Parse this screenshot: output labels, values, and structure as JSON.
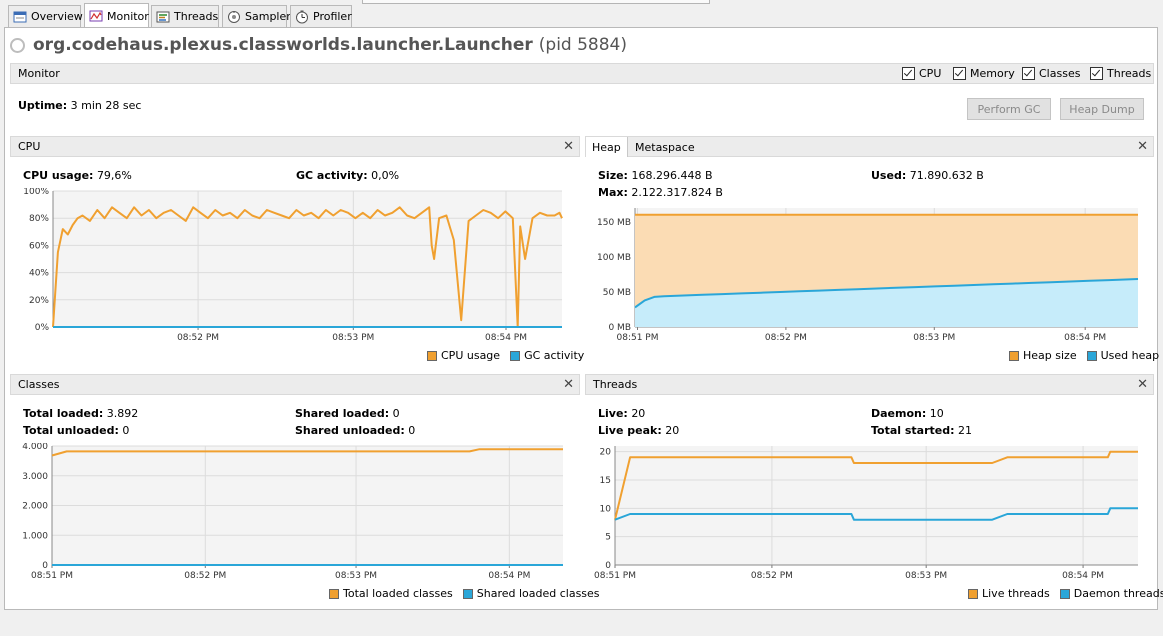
{
  "tabs": [
    {
      "label": "Overview",
      "icon": "overview-icon"
    },
    {
      "label": "Monitor",
      "icon": "monitor-icon"
    },
    {
      "label": "Threads",
      "icon": "threads-icon"
    },
    {
      "label": "Sampler",
      "icon": "sampler-icon"
    },
    {
      "label": "Profiler",
      "icon": "profiler-icon"
    }
  ],
  "app": {
    "name": "org.codehaus.plexus.classworlds.launcher.Launcher",
    "pid": "(pid 5884)"
  },
  "monitor": {
    "label": "Monitor",
    "checks": [
      {
        "label": "CPU"
      },
      {
        "label": "Memory"
      },
      {
        "label": "Classes"
      },
      {
        "label": "Threads"
      }
    ],
    "uptime_label": "Uptime:",
    "uptime_value": "3 min 28 sec",
    "perform_gc": "Perform GC",
    "heap_dump": "Heap Dump"
  },
  "colors": {
    "orange": "#f0a030",
    "blue": "#2aa6d8",
    "orange_fill": "#fbdcb4",
    "blue_fill": "#c6ecfa"
  },
  "cpu": {
    "title": "CPU",
    "usage_label": "CPU usage:",
    "usage_value": "79,6%",
    "gc_label": "GC activity:",
    "gc_value": "0,0%",
    "legend": [
      "CPU usage",
      "GC activity"
    ]
  },
  "heap": {
    "tab1": "Heap",
    "tab2": "Metaspace",
    "size_label": "Size:",
    "size_value": "168.296.448 B",
    "max_label": "Max:",
    "max_value": "2.122.317.824 B",
    "used_label": "Used:",
    "used_value": "71.890.632 B",
    "legend": [
      "Heap size",
      "Used heap"
    ]
  },
  "classes": {
    "title": "Classes",
    "total_loaded_label": "Total loaded:",
    "total_loaded_value": "3.892",
    "total_unloaded_label": "Total unloaded:",
    "total_unloaded_value": "0",
    "shared_loaded_label": "Shared loaded:",
    "shared_loaded_value": "0",
    "shared_unloaded_label": "Shared unloaded:",
    "shared_unloaded_value": "0",
    "legend": [
      "Total loaded classes",
      "Shared loaded classes"
    ]
  },
  "threads": {
    "title": "Threads",
    "live_label": "Live:",
    "live_value": "20",
    "peak_label": "Live peak:",
    "peak_value": "20",
    "daemon_label": "Daemon:",
    "daemon_value": "10",
    "started_label": "Total started:",
    "started_value": "21",
    "legend": [
      "Live threads",
      "Daemon threads"
    ]
  },
  "chart_data": [
    {
      "type": "line",
      "name": "cpu",
      "x_ticks": [
        "08:52 PM",
        "08:53 PM",
        "08:54 PM"
      ],
      "y_ticks": [
        "0%",
        "20%",
        "40%",
        "60%",
        "80%",
        "100%"
      ],
      "ylim": [
        0,
        100
      ],
      "xlim": [
        0,
        207
      ],
      "series": [
        {
          "name": "CPU usage",
          "color": "#f0a030",
          "x": [
            0,
            2,
            4,
            6,
            8,
            10,
            12,
            15,
            18,
            21,
            24,
            27,
            30,
            33,
            36,
            39,
            42,
            45,
            48,
            51,
            54,
            57,
            60,
            63,
            66,
            69,
            72,
            75,
            78,
            81,
            84,
            87,
            90,
            93,
            96,
            99,
            102,
            105,
            108,
            111,
            114,
            117,
            120,
            123,
            126,
            129,
            132,
            135,
            138,
            141,
            144,
            147,
            150,
            153,
            154,
            155,
            157,
            160,
            163,
            166,
            169,
            172,
            175,
            178,
            181,
            184,
            187,
            189,
            190,
            192,
            195,
            198,
            201,
            204,
            206,
            207
          ],
          "y": [
            0,
            55,
            72,
            68,
            75,
            80,
            82,
            78,
            86,
            80,
            88,
            84,
            80,
            88,
            82,
            86,
            80,
            84,
            86,
            82,
            78,
            88,
            84,
            80,
            86,
            82,
            84,
            80,
            86,
            82,
            80,
            86,
            84,
            82,
            80,
            86,
            82,
            84,
            80,
            86,
            82,
            86,
            84,
            80,
            84,
            80,
            86,
            82,
            84,
            88,
            82,
            80,
            84,
            88,
            60,
            50,
            80,
            82,
            64,
            5,
            78,
            82,
            86,
            84,
            80,
            85,
            80,
            0,
            74,
            50,
            80,
            84,
            82,
            82,
            84,
            80
          ]
        },
        {
          "name": "GC activity",
          "color": "#2aa6d8",
          "x": [
            0,
            207
          ],
          "y": [
            0,
            0
          ]
        }
      ]
    },
    {
      "type": "area",
      "name": "heap",
      "x_ticks": [
        "08:51 PM",
        "08:52 PM",
        "08:53 PM",
        "08:54 PM"
      ],
      "y_ticks": [
        "0 MB",
        "50 MB",
        "100 MB",
        "150 MB"
      ],
      "ylim": [
        0,
        170
      ],
      "xlim": [
        0,
        208
      ],
      "series": [
        {
          "name": "Heap size",
          "color": "#f0a030",
          "x": [
            0,
            208
          ],
          "y": [
            160.5,
            160.5
          ]
        },
        {
          "name": "Used heap",
          "color": "#2aa6d8",
          "x": [
            0,
            4,
            8,
            12,
            20,
            28,
            36,
            44,
            52,
            60,
            68,
            76,
            84,
            92,
            100,
            108,
            116,
            124,
            132,
            140,
            148,
            156,
            164,
            172,
            180,
            188,
            196,
            204,
            208
          ],
          "y": [
            28,
            38,
            43,
            44,
            45,
            46,
            47,
            48,
            49,
            50,
            51,
            52,
            53,
            54,
            55,
            56,
            57,
            58,
            59,
            60,
            61,
            62,
            63,
            64,
            65,
            66,
            67,
            68,
            68.5
          ]
        }
      ]
    },
    {
      "type": "line",
      "name": "classes",
      "x_ticks": [
        "08:51 PM",
        "08:52 PM",
        "08:53 PM",
        "08:54 PM"
      ],
      "y_ticks": [
        "0",
        "1.000",
        "2.000",
        "3.000",
        "4.000"
      ],
      "ylim": [
        0,
        4000
      ],
      "xlim": [
        0,
        208
      ],
      "series": [
        {
          "name": "Total loaded classes",
          "color": "#f0a030",
          "x": [
            0,
            6,
            170,
            174,
            208
          ],
          "y": [
            3680,
            3820,
            3820,
            3892,
            3892
          ]
        },
        {
          "name": "Shared loaded classes",
          "color": "#2aa6d8",
          "x": [
            0,
            208
          ],
          "y": [
            0,
            0
          ]
        }
      ]
    },
    {
      "type": "line",
      "name": "threads",
      "x_ticks": [
        "08:51 PM",
        "08:52 PM",
        "08:53 PM",
        "08:54 PM"
      ],
      "y_ticks": [
        "0",
        "5",
        "10",
        "15",
        "20"
      ],
      "ylim": [
        0,
        21
      ],
      "xlim": [
        0,
        208
      ],
      "series": [
        {
          "name": "Live threads",
          "color": "#f0a030",
          "x": [
            0,
            6,
            94,
            95,
            150,
            156,
            196,
            197,
            208
          ],
          "y": [
            8,
            19,
            19,
            18,
            18,
            19,
            19,
            20,
            20
          ]
        },
        {
          "name": "Daemon threads",
          "color": "#2aa6d8",
          "x": [
            0,
            6,
            94,
            95,
            150,
            156,
            196,
            197,
            208
          ],
          "y": [
            8,
            9,
            9,
            8,
            8,
            9,
            9,
            10,
            10
          ]
        }
      ]
    }
  ]
}
